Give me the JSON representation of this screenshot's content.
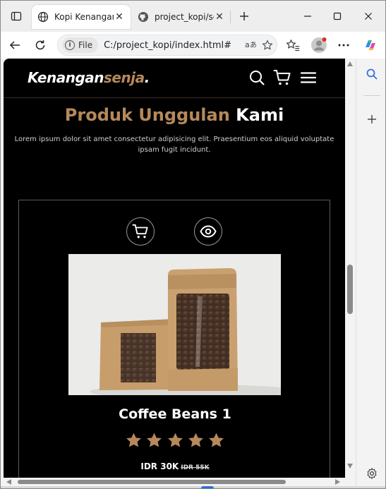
{
  "browser": {
    "tabs": [
      {
        "label": "Kopi Kenangan Senja",
        "active": true,
        "icon": "globe-icon"
      },
      {
        "label": "project_kopi/script.js",
        "active": false,
        "icon": "github-icon"
      }
    ],
    "address": {
      "chip_label": "File",
      "url": "C:/project_kopi/index.html#"
    }
  },
  "site": {
    "logo_main": "Kenangan",
    "logo_accent": "senja",
    "logo_dot": ".",
    "section": {
      "title_accent": "Produk Unggulan",
      "title_rest": " Kami",
      "description": "Lorem ipsum dolor sit amet consectetur adipisicing elit. Praesentium eos aliquid voluptate ipsam fugit incidunt."
    },
    "product": {
      "name": "Coffee Beans 1",
      "rating": 5,
      "price": "IDR 30K",
      "old_price": "IDR 55K"
    }
  },
  "colors": {
    "accent": "#b6895b",
    "background": "#000000",
    "star": "#b6895b"
  }
}
